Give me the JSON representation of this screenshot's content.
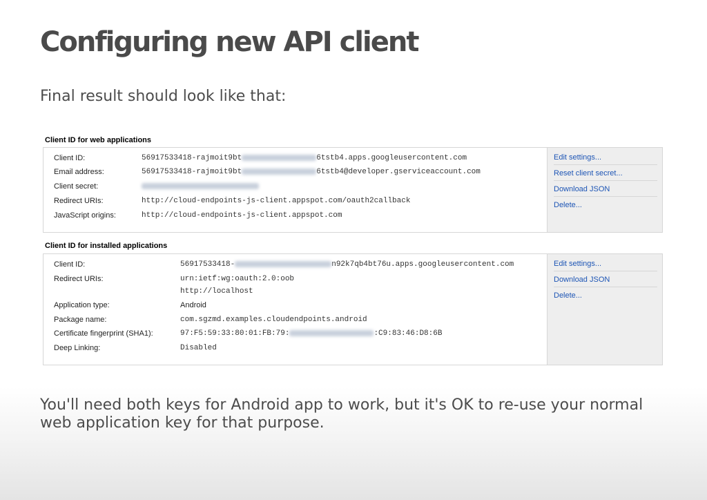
{
  "title": "Configuring new API client",
  "intro": "Final result should look like that:",
  "outro": "You'll need both keys for Android app to work, but it's OK to re-use your normal web application key for that purpose.",
  "web": {
    "heading": "Client ID for web applications",
    "rows": [
      {
        "label": "Client ID:",
        "pre": "56917533418-rajmoit9bt",
        "post": "6tstb4.apps.googleusercontent.com"
      },
      {
        "label": "Email address:",
        "pre": "56917533418-rajmoit9bt",
        "post": "6tstb4@developer.gserviceaccount.com"
      },
      {
        "label": "Client secret:"
      },
      {
        "label": "Redirect URIs:",
        "value": "http://cloud-endpoints-js-client.appspot.com/oauth2callback"
      },
      {
        "label": "JavaScript origins:",
        "value": "http://cloud-endpoints-js-client.appspot.com"
      }
    ],
    "links": [
      "Edit settings...",
      "Reset client secret...",
      "Download JSON",
      "Delete..."
    ]
  },
  "installed": {
    "heading": "Client ID for installed applications",
    "rows": [
      {
        "label": "Client ID:",
        "pre": "56917533418-",
        "post": "n92k7qb4bt76u.apps.googleusercontent.com"
      },
      {
        "label": "Redirect URIs:",
        "value": "urn:ietf:wg:oauth:2.0:oob",
        "value2": "http://localhost"
      },
      {
        "label": "Application type:",
        "value": "Android"
      },
      {
        "label": "Package name:",
        "value": "com.sgzmd.examples.cloudendpoints.android"
      },
      {
        "label": "Certificate fingerprint (SHA1):",
        "pre": "97:F5:59:33:80:01:FB:79:",
        "post": ":C9:83:46:D8:6B"
      },
      {
        "label": "Deep Linking:",
        "value": "Disabled"
      }
    ],
    "links": [
      "Edit settings...",
      "Download JSON",
      "Delete..."
    ]
  }
}
